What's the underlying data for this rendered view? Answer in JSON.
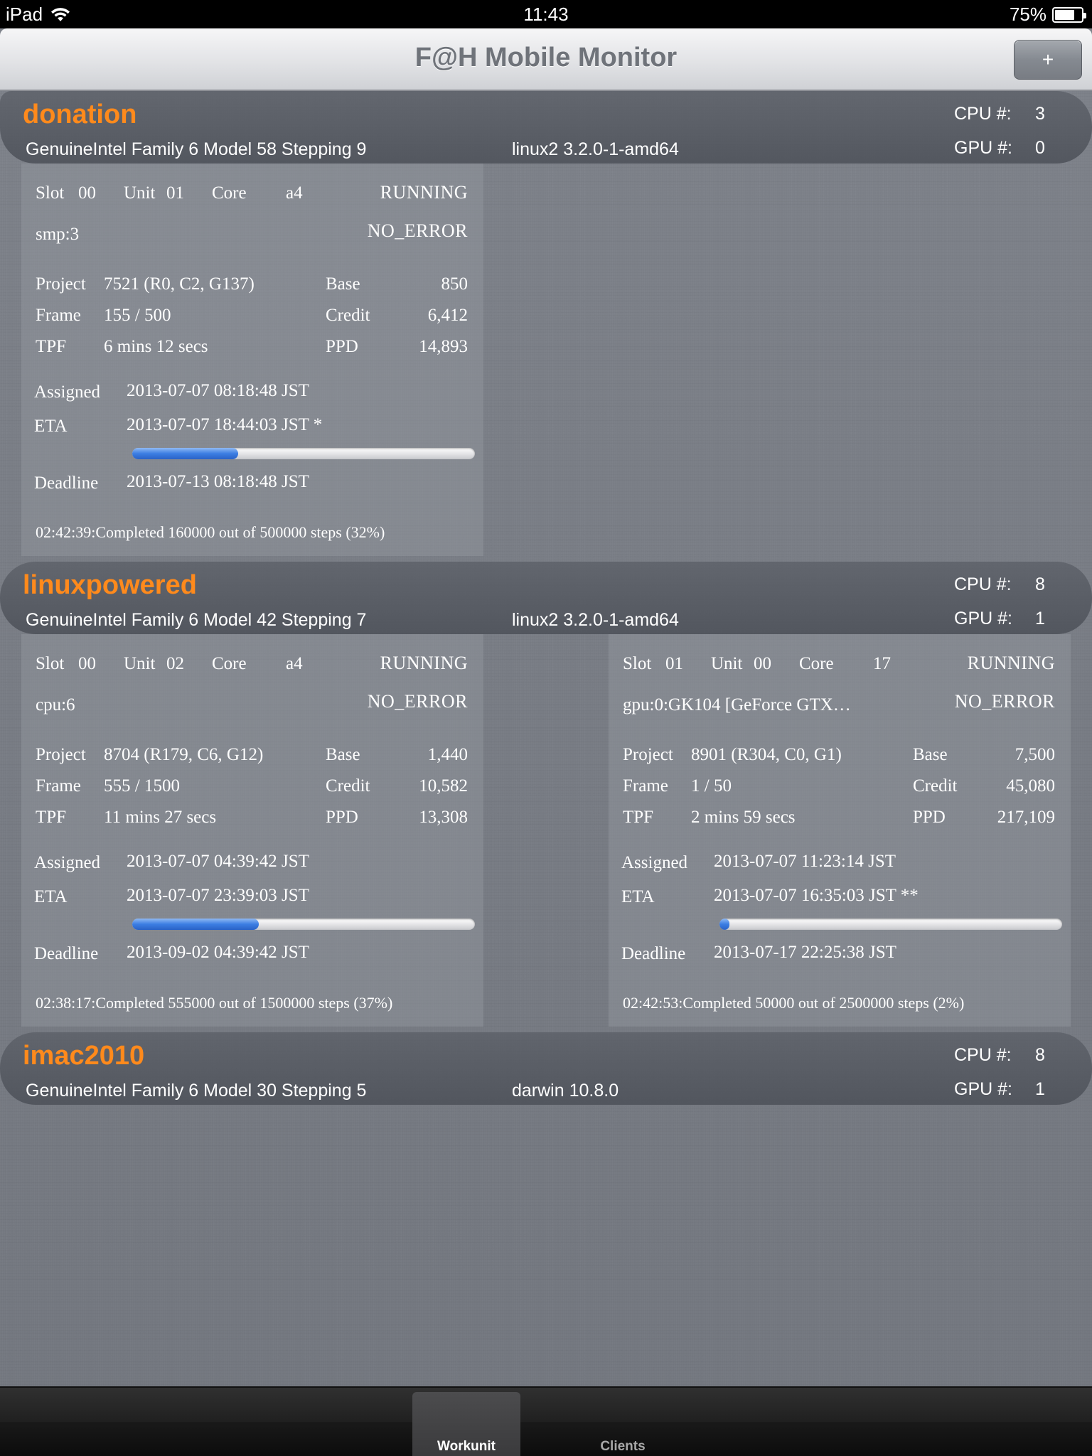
{
  "status_bar": {
    "device": "iPad",
    "time": "11:43",
    "battery_percent": "75%",
    "battery_level": 0.75
  },
  "nav": {
    "title": "F@H Mobile Monitor",
    "add_label": "+"
  },
  "labels": {
    "slot": "Slot",
    "unit": "Unit",
    "core": "Core",
    "project": "Project",
    "frame": "Frame",
    "tpf": "TPF",
    "base": "Base",
    "credit": "Credit",
    "ppd": "PPD",
    "assigned": "Assigned",
    "eta": "ETA",
    "deadline": "Deadline",
    "cpu_count": "CPU #:",
    "gpu_count": "GPU #:"
  },
  "hosts": [
    {
      "name": "donation",
      "cpu_desc": "GenuineIntel Family 6 Model 58 Stepping 9",
      "os": "linux2 3.2.0-1-amd64",
      "cpu_count": "3",
      "gpu_count": "0",
      "workunits": [
        {
          "slot": "00",
          "unit": "01",
          "core": "a4",
          "state": "RUNNING",
          "resource": "smp:3",
          "error": "NO_ERROR",
          "project": "7521 (R0, C2, G137)",
          "frame": "155 / 500",
          "tpf": "6 mins 12 secs",
          "base": "850",
          "credit": "6,412",
          "ppd": "14,893",
          "assigned": "2013-07-07 08:18:48 JST",
          "eta": "2013-07-07 18:44:03 JST *",
          "deadline": "2013-07-13 08:18:48 JST",
          "progress": 0.31,
          "log": "02:42:39:Completed 160000 out of 500000 steps  (32%)"
        }
      ]
    },
    {
      "name": "linuxpowered",
      "cpu_desc": "GenuineIntel Family 6 Model 42 Stepping 7",
      "os": "linux2 3.2.0-1-amd64",
      "cpu_count": "8",
      "gpu_count": "1",
      "workunits": [
        {
          "slot": "00",
          "unit": "02",
          "core": "a4",
          "state": "RUNNING",
          "resource": "cpu:6",
          "error": "NO_ERROR",
          "project": "8704 (R179, C6, G12)",
          "frame": "555 / 1500",
          "tpf": "11 mins 27 secs",
          "base": "1,440",
          "credit": "10,582",
          "ppd": "13,308",
          "assigned": "2013-07-07 04:39:42 JST",
          "eta": "2013-07-07 23:39:03 JST",
          "deadline": "2013-09-02 04:39:42 JST",
          "progress": 0.37,
          "log": "02:38:17:Completed 555000 out of 1500000 steps  (37%)"
        },
        {
          "slot": "01",
          "unit": "00",
          "core": "17",
          "state": "RUNNING",
          "resource": "gpu:0:GK104 [GeForce GTX…",
          "error": "NO_ERROR",
          "project": "8901 (R304, C0, G1)",
          "frame": "1 / 50",
          "tpf": "2 mins 59 secs",
          "base": "7,500",
          "credit": "45,080",
          "ppd": "217,109",
          "assigned": "2013-07-07 11:23:14 JST",
          "eta": "2013-07-07 16:35:03 JST **",
          "deadline": "2013-07-17 22:25:38 JST",
          "progress": 0.02,
          "log": "02:42:53:Completed 50000 out of 2500000 steps (2%)"
        }
      ]
    },
    {
      "name": "imac2010",
      "cpu_desc": "GenuineIntel Family 6 Model 30 Stepping 5",
      "os": "darwin 10.8.0",
      "cpu_count": "8",
      "gpu_count": "1",
      "workunits": []
    }
  ],
  "tabs": [
    {
      "label": "Workunit",
      "selected": true
    },
    {
      "label": "Clients",
      "selected": false
    }
  ],
  "icons": {
    "wifi": "wifi-icon",
    "battery": "battery-icon",
    "add": "plus-icon"
  },
  "colors": {
    "host_name": "#ff8a1c",
    "progress": "#3c7ee3"
  }
}
